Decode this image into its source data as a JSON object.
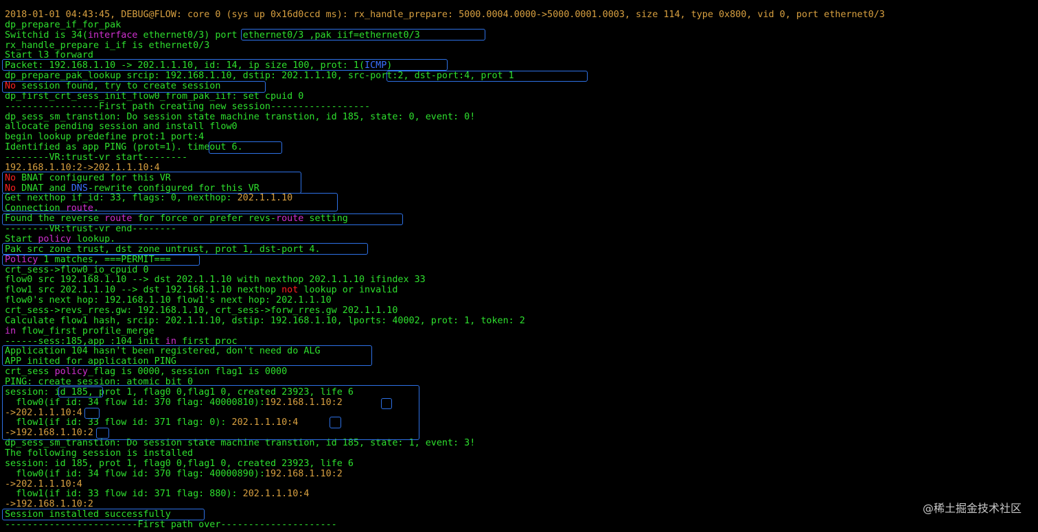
{
  "colors": {
    "background": "#000000",
    "text_default": "#2ee02e",
    "text_value": "#d8a040",
    "keyword": "#d030d0",
    "negation": "#ff2020",
    "protocol": "#3a70ff",
    "highlight_box": "#2e72e8"
  },
  "terminal": {
    "lines": [
      [
        [
          "o",
          "2018-01-01 04:43:45, DEBUG@FLOW: core 0 (sys up 0x16d0ccd ms): rx_handle_prepare: 5000.0004.0000->5000.0001.0003, size 114, type 0x800, vid 0, port ethernet0/3"
        ]
      ],
      [
        [
          "g",
          "dp_prepare_if_for_pak"
        ]
      ],
      [
        [
          "g",
          "Switchid is 34("
        ],
        [
          "m",
          "interface"
        ],
        [
          "g",
          " ethernet0/3) port ethernet0/3 ,pak iif=ethernet0/3"
        ]
      ],
      [
        [
          "g",
          "rx_handle_prepare i_if is ethernet0/3"
        ]
      ],
      [
        [
          "g",
          "Start l3 forward"
        ]
      ],
      [
        [
          "g",
          "Packet: 192.168.1.10 -> 202.1.1.10, id: 14, ip size 100, prot: 1("
        ],
        [
          "b",
          "ICMP"
        ],
        [
          "g",
          ")"
        ]
      ],
      [
        [
          "g",
          "dp_prepare_pak_lookup srcip: 192.168.1.10, dstip: 202.1.1.10, src-port:2, dst-port:4, prot 1"
        ]
      ],
      [
        [
          "r",
          "No"
        ],
        [
          "g",
          " session found, try to create session"
        ]
      ],
      [
        [
          "g",
          "dp_first_crt_sess_init_flow0_from_pak_iif: set cpuid 0"
        ]
      ],
      [
        [
          "g",
          "-----------------First path creating new session------------------"
        ]
      ],
      [
        [
          "g",
          "dp_sess_sm_transtion: Do session state machine transtion, id 185, state: 0, event: 0!"
        ]
      ],
      [
        [
          "g",
          "allocate pending session and install flow0"
        ]
      ],
      [
        [
          "g",
          "begin lookup predefine prot:1 port:4"
        ]
      ],
      [
        [
          "g",
          "Identified as app PING (prot=1). timeout 6."
        ]
      ],
      [
        [
          "g",
          "--------VR:trust-vr start--------"
        ]
      ],
      [
        [
          "o",
          "192.168.1.10:2->202.1.1.10:4"
        ]
      ],
      [
        [
          "r",
          "No"
        ],
        [
          "g",
          " BNAT configured for this VR"
        ]
      ],
      [
        [
          "r",
          "No"
        ],
        [
          "g",
          " DNAT and "
        ],
        [
          "b",
          "DNS"
        ],
        [
          "g",
          "-rewrite configured for this VR"
        ]
      ],
      [
        [
          "g",
          "Get nexthop if_id: 33, flags: 0, nexthop: "
        ],
        [
          "o",
          "202.1.1.10"
        ]
      ],
      [
        [
          "g",
          "Connection "
        ],
        [
          "m",
          "route"
        ],
        [
          "g",
          "."
        ]
      ],
      [
        [
          "g",
          "Found the reverse "
        ],
        [
          "m",
          "route"
        ],
        [
          "g",
          " for force or prefer revs-"
        ],
        [
          "m",
          "route"
        ],
        [
          "g",
          " setting"
        ]
      ],
      [
        [
          "g",
          "--------VR:trust-vr end--------"
        ]
      ],
      [
        [
          "g",
          "Start "
        ],
        [
          "m",
          "policy"
        ],
        [
          "g",
          " lookup."
        ]
      ],
      [
        [
          "g",
          "Pak src zone trust, dst zone untrust, prot 1, dst-port 4."
        ]
      ],
      [
        [
          "m",
          "Policy"
        ],
        [
          "g",
          " 1 matches, ===PERMIT==="
        ]
      ],
      [
        [
          "g",
          "crt_sess->flow0_io_cpuid 0"
        ]
      ],
      [
        [
          "g",
          "flow0 src 192.168.1.10 --> dst 202.1.1.10 with nexthop 202.1.1.10 ifindex 33"
        ]
      ],
      [
        [
          "g",
          "flow1 src 202.1.1.10 --> dst 192.168.1.10 nexthop "
        ],
        [
          "r",
          "not"
        ],
        [
          "g",
          " lookup or invalid"
        ]
      ],
      [
        [
          "g",
          "flow0's next hop: 192.168.1.10 flow1's next hop: 202.1.1.10"
        ]
      ],
      [
        [
          "g",
          "crt_sess->revs_rres.gw: 192.168.1.10, crt_sess->forw_rres.gw 202.1.1.10"
        ]
      ],
      [
        [
          "g",
          "Calculate flow1 hash, srcip: 202.1.1.10, dstip: 192.168.1.10, lports: 40002, prot: 1, token: 2"
        ]
      ],
      [
        [
          "m",
          "in"
        ],
        [
          "g",
          " flow_first profile_merge"
        ]
      ],
      [
        [
          "g",
          "------sess:185,app :104 init "
        ],
        [
          "m",
          "in"
        ],
        [
          "g",
          " first proc"
        ]
      ],
      [
        [
          "g",
          "Application 104 hasn't been registered, don't need do ALG"
        ]
      ],
      [
        [
          "g",
          "APP inited for application PING"
        ]
      ],
      [
        [
          "g",
          "crt_sess "
        ],
        [
          "m",
          "policy"
        ],
        [
          "g",
          "_flag is 0000, session flag1 is 0000"
        ]
      ],
      [
        [
          "g",
          "PING: create session: atomic bit 0"
        ]
      ],
      [
        [
          "g",
          "session: id 185, prot 1, flag0 0,flag1 0, created 23923, life 6"
        ]
      ],
      [
        [
          "g",
          "  flow0(if id: 34 flow id: 370 flag: 40000810):"
        ],
        [
          "o",
          "192.168.1.10:2"
        ]
      ],
      [
        [
          "o",
          "->202.1.1.10:4"
        ]
      ],
      [
        [
          "g",
          "  flow1(if id: 33 flow id: 371 flag: 0): "
        ],
        [
          "o",
          "202.1.1.10:4"
        ]
      ],
      [
        [
          "o",
          "->192.168.1.10:2"
        ]
      ],
      [
        [
          "g",
          "dp_sess_sm_transtion: Do session state machine transtion, id 185, state: 1, event: 3!"
        ]
      ],
      [
        [
          "g",
          "The following session is installed"
        ]
      ],
      [
        [
          "g",
          "session: id 185, prot 1, flag0 0,flag1 0, created 23923, life 6"
        ]
      ],
      [
        [
          "g",
          "  flow0(if id: 34 flow id: 370 flag: 40000890):"
        ],
        [
          "o",
          "192.168.1.10:2"
        ]
      ],
      [
        [
          "o",
          "->202.1.1.10:4"
        ]
      ],
      [
        [
          "g",
          "  flow1(if id: 33 flow id: 371 flag: 880): "
        ],
        [
          "o",
          "202.1.1.10:4"
        ]
      ],
      [
        [
          "o",
          "->192.168.1.10:2"
        ]
      ],
      [
        [
          "g",
          "Session installed successfully"
        ]
      ],
      [
        [
          "g",
          "------------------------First path over---------------------"
        ]
      ]
    ]
  },
  "watermark": "@稀土掘金技术社区"
}
